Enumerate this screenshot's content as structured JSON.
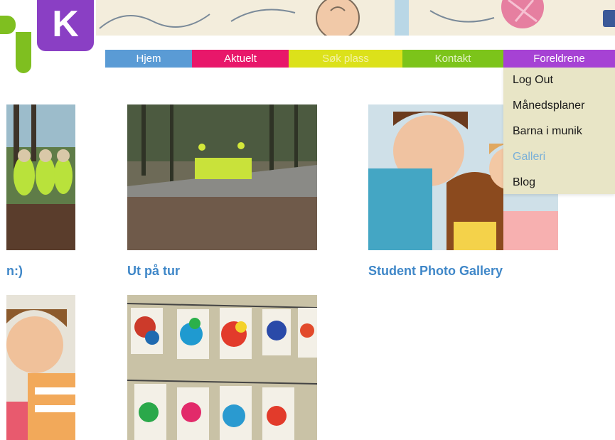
{
  "logo": {
    "letter": "K"
  },
  "nav": {
    "items": [
      {
        "label": "Hjem"
      },
      {
        "label": "Aktuelt"
      },
      {
        "label": "Søk plass"
      },
      {
        "label": "Kontakt"
      },
      {
        "label": "Foreldrene"
      }
    ]
  },
  "dropdown": {
    "items": [
      {
        "label": "Log Out"
      },
      {
        "label": "Månedsplaner"
      },
      {
        "label": "Barna i munik"
      },
      {
        "label": "Galleri"
      },
      {
        "label": "Blog"
      }
    ],
    "active": "Galleri"
  },
  "gallery": {
    "albums": [
      {
        "caption": "n:)"
      },
      {
        "caption": "Ut på tur"
      },
      {
        "caption": "Student Photo Gallery"
      }
    ]
  },
  "colors": {
    "nav_home": "#5a9bd5",
    "nav_news": "#e8176a",
    "nav_apply": "#dce11a",
    "nav_contact": "#7cc41a",
    "nav_parents": "#a642d4",
    "link": "#3f87c8"
  }
}
